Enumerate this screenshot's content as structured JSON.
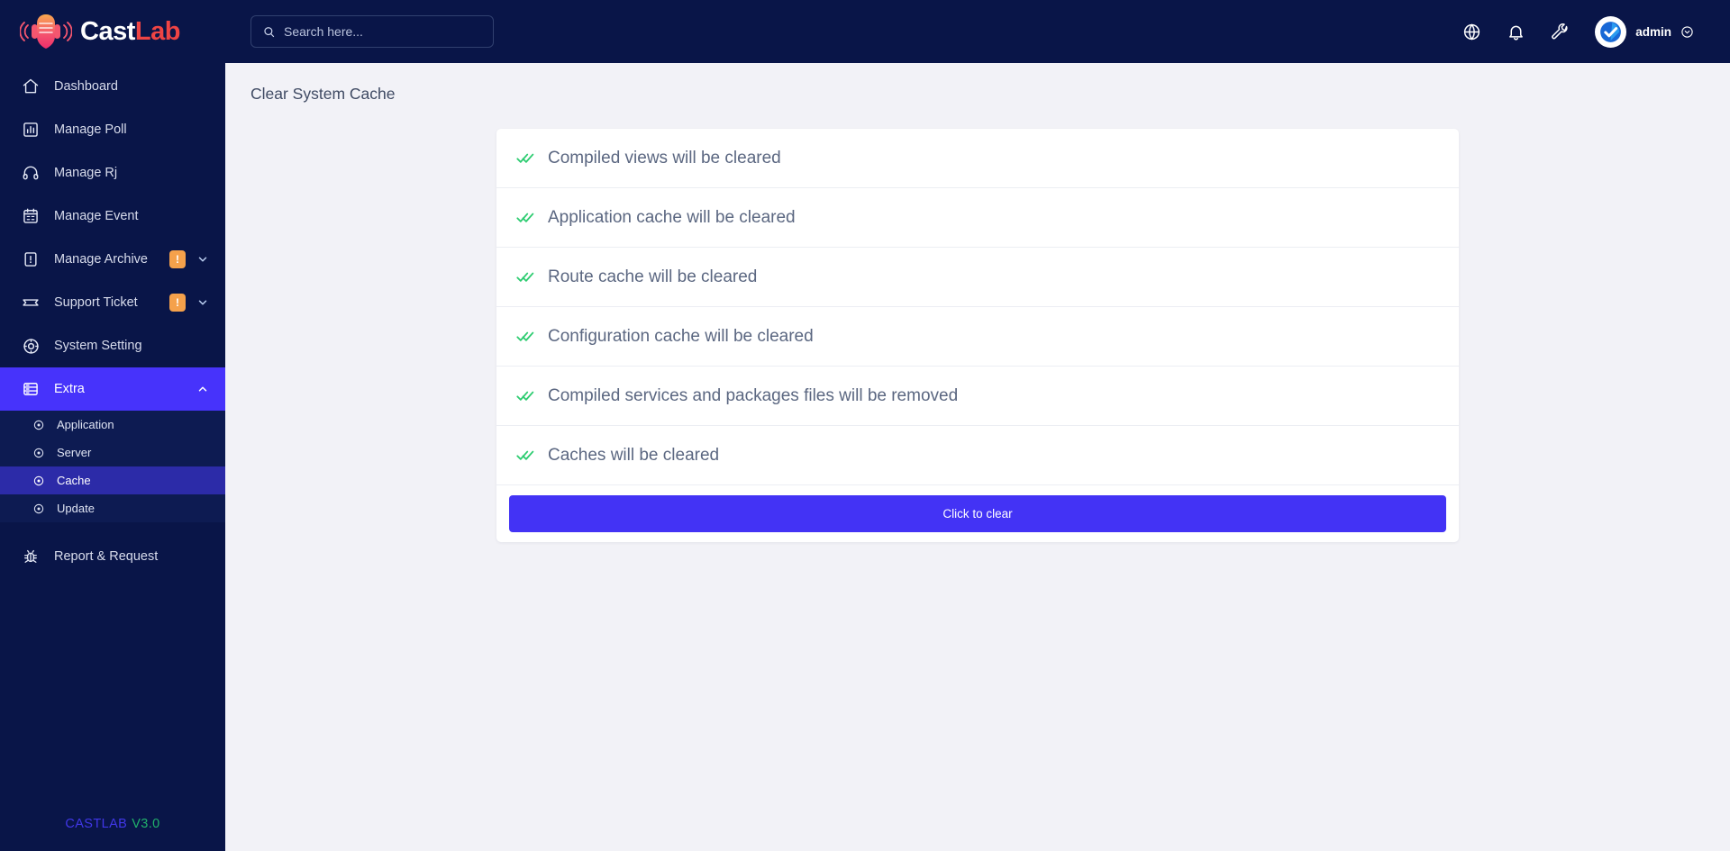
{
  "brand": {
    "name_part1": "Cast",
    "name_part2": "Lab",
    "icon": "podcast-mic-icon"
  },
  "sidebar": {
    "items": [
      {
        "label": "Dashboard",
        "icon": "home-icon",
        "badge": null,
        "expandable": false,
        "active": false
      },
      {
        "label": "Manage Poll",
        "icon": "bar-chart-icon",
        "badge": null,
        "expandable": false,
        "active": false
      },
      {
        "label": "Manage Rj",
        "icon": "headphones-icon",
        "badge": null,
        "expandable": false,
        "active": false
      },
      {
        "label": "Manage Event",
        "icon": "calendar-icon",
        "badge": null,
        "expandable": false,
        "active": false
      },
      {
        "label": "Manage Archive",
        "icon": "archive-icon",
        "badge": "!",
        "expandable": true,
        "active": false
      },
      {
        "label": "Support Ticket",
        "icon": "ticket-icon",
        "badge": "!",
        "expandable": true,
        "active": false
      },
      {
        "label": "System Setting",
        "icon": "gear-icon",
        "badge": null,
        "expandable": false,
        "active": false
      },
      {
        "label": "Extra",
        "icon": "server-list-icon",
        "badge": null,
        "expandable": true,
        "active": true
      }
    ],
    "submenu": [
      {
        "label": "Application",
        "icon": "circle-dot-icon",
        "active": false
      },
      {
        "label": "Server",
        "icon": "circle-dot-icon",
        "active": false
      },
      {
        "label": "Cache",
        "icon": "circle-dot-icon",
        "active": true
      },
      {
        "label": "Update",
        "icon": "circle-dot-icon",
        "active": false
      }
    ],
    "bottom_item": {
      "label": "Report & Request",
      "icon": "bug-icon"
    },
    "footer": {
      "name": "CASTLAB",
      "version": "V3.0"
    }
  },
  "topbar": {
    "search": {
      "placeholder": "Search here...",
      "value": "",
      "icon": "search-icon"
    },
    "icons": [
      {
        "name": "globe-icon"
      },
      {
        "name": "bell-icon"
      },
      {
        "name": "wrench-icon"
      }
    ],
    "user": {
      "name": "admin",
      "avatar": "verified-check-avatar",
      "caret": "chevron-down-circle-icon"
    }
  },
  "page": {
    "title": "Clear System Cache",
    "rows": [
      {
        "icon": "double-check-icon",
        "text": "Compiled views will be cleared"
      },
      {
        "icon": "double-check-icon",
        "text": "Application cache will be cleared"
      },
      {
        "icon": "double-check-icon",
        "text": "Route cache will be cleared"
      },
      {
        "icon": "double-check-icon",
        "text": "Configuration cache will be cleared"
      },
      {
        "icon": "double-check-icon",
        "text": "Compiled services and packages files will be removed"
      },
      {
        "icon": "double-check-icon",
        "text": "Caches will be cleared"
      }
    ],
    "clear_button": "Click to clear"
  },
  "colors": {
    "sidebar_bg": "#091548",
    "sidebar_active": "#4733fb",
    "submenu_bg": "#0d1b52",
    "submenu_active": "#2c2ba8",
    "badge_orange": "#f5a14b",
    "button_indigo": "#4333f5",
    "check_green": "#2ecc71",
    "content_bg": "#f2f2f7",
    "brand_red": "#ef4444",
    "footer_version_green": "#21b26b"
  }
}
